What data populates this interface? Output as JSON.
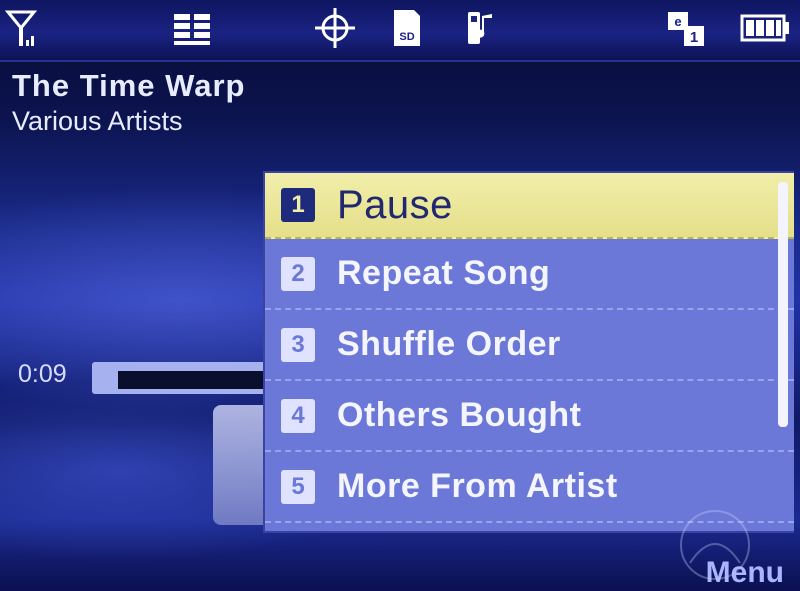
{
  "status_bar": {
    "icons": [
      "signal-strength-icon",
      "network-bars-icon",
      "gps-icon",
      "sd-card-icon",
      "phone-music-icon",
      "email-notification-icon",
      "battery-icon"
    ],
    "sd_label": "SD",
    "email_count": "1"
  },
  "now_playing": {
    "title": "The Time Warp",
    "artist": "Various Artists",
    "elapsed": "0:09"
  },
  "menu": {
    "items": [
      {
        "number": "1",
        "label": "Pause",
        "selected": true
      },
      {
        "number": "2",
        "label": "Repeat Song"
      },
      {
        "number": "3",
        "label": "Shuffle Order"
      },
      {
        "number": "4",
        "label": "Others Bought"
      },
      {
        "number": "5",
        "label": "More From Artist"
      }
    ]
  },
  "softkeys": {
    "right": "Menu"
  },
  "colors": {
    "menu_background": "#6b78d7",
    "selection": "#f1eeaa",
    "status_bar": "#1a2383"
  }
}
